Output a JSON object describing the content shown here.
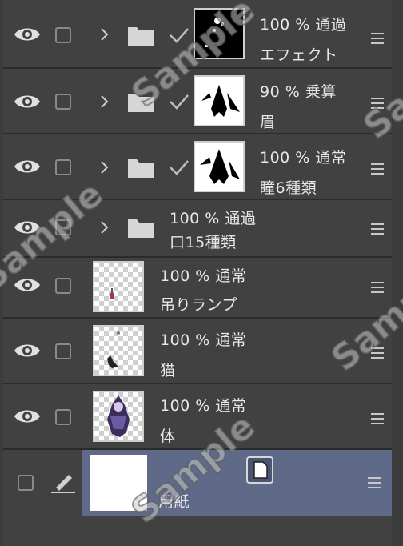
{
  "layers": [
    {
      "id": "effect",
      "opacity": "100 %",
      "blend": "通過",
      "name": "エフェクト"
    },
    {
      "id": "eyebrow",
      "opacity": "90 %",
      "blend": "乗算",
      "name": "眉"
    },
    {
      "id": "pupil",
      "opacity": "100 %",
      "blend": "通常",
      "name": "瞳6種類"
    },
    {
      "id": "mouth",
      "opacity": "100 %",
      "blend": "通過",
      "name": "口15種類"
    },
    {
      "id": "lamp",
      "opacity": "100 %",
      "blend": "通常",
      "name": "吊りランプ"
    },
    {
      "id": "cat",
      "opacity": "100 %",
      "blend": "通常",
      "name": "猫"
    },
    {
      "id": "body",
      "opacity": "100 %",
      "blend": "通常",
      "name": "体"
    }
  ],
  "paper": {
    "name": "用紙"
  },
  "watermark": "Sample",
  "icons": {
    "visibility": "eye-icon",
    "expand": "chevron-right-icon",
    "folder": "folder-icon",
    "clip": "check-icon",
    "edit": "pen-icon",
    "menu": "hamburger-icon",
    "paper": "paper-icon"
  }
}
